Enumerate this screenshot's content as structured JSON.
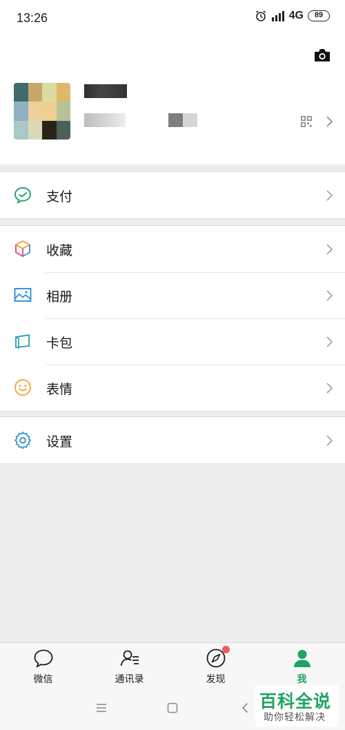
{
  "status_bar": {
    "time": "13:26",
    "network": "4G",
    "battery": "89"
  },
  "menu": {
    "group1": [
      {
        "label": "支付",
        "icon": "wallet-icon"
      }
    ],
    "group2": [
      {
        "label": "收藏",
        "icon": "favorites-cube-icon"
      },
      {
        "label": "相册",
        "icon": "album-icon"
      },
      {
        "label": "卡包",
        "icon": "card-icon"
      },
      {
        "label": "表情",
        "icon": "sticker-icon"
      }
    ],
    "group3": [
      {
        "label": "设置",
        "icon": "settings-icon"
      }
    ]
  },
  "tabbar": {
    "tabs": [
      {
        "label": "微信",
        "icon": "chat-bubble-icon",
        "active": false
      },
      {
        "label": "通讯录",
        "icon": "contacts-icon",
        "active": false
      },
      {
        "label": "发现",
        "icon": "compass-icon",
        "active": false,
        "badge_dot": true
      },
      {
        "label": "我",
        "icon": "person-icon",
        "active": true
      }
    ],
    "active_color": "#1fa463",
    "badge_color": "#f25c5c"
  },
  "watermark": {
    "title": "百科全说",
    "subtitle": "助你轻松解决"
  }
}
